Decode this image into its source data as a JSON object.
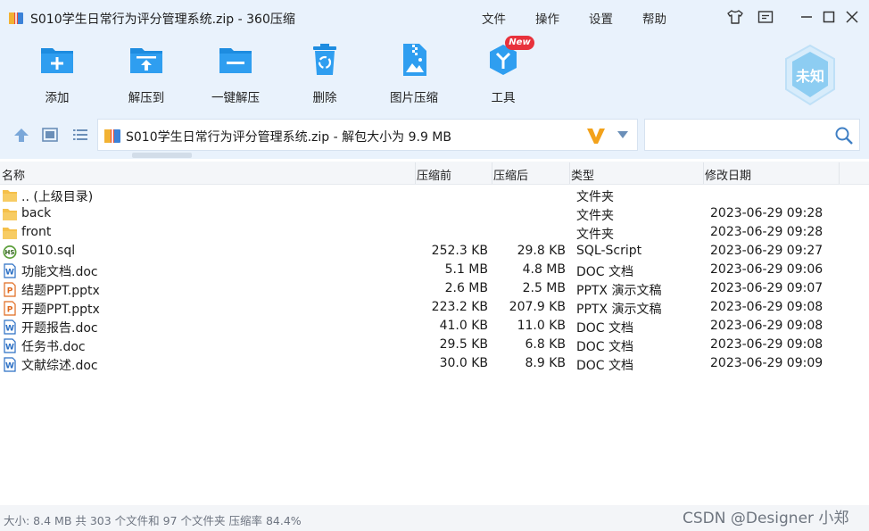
{
  "window": {
    "title": "S010学生日常行为评分管理系统.zip - 360压缩",
    "menu": [
      "文件",
      "操作",
      "设置",
      "帮助"
    ]
  },
  "toolbar": {
    "buttons": [
      {
        "label": "添加",
        "icon": "add-icon"
      },
      {
        "label": "解压到",
        "icon": "extract-to-icon"
      },
      {
        "label": "一键解压",
        "icon": "one-click-extract-icon"
      },
      {
        "label": "删除",
        "icon": "delete-icon"
      },
      {
        "label": "图片压缩",
        "icon": "image-compress-icon"
      },
      {
        "label": "工具",
        "icon": "tools-icon"
      }
    ],
    "new_badge": "New",
    "status_badge": "未知"
  },
  "address": {
    "path": "S010学生日常行为评分管理系统.zip - 解包大小为 9.9 MB",
    "search_value": ""
  },
  "columns": [
    "名称",
    "压缩前",
    "压缩后",
    "类型",
    "修改日期"
  ],
  "files": [
    {
      "name": ".. (上级目录)",
      "compressed": "",
      "original": "",
      "type": "文件夹",
      "date": "",
      "icon": "folder-up-icon"
    },
    {
      "name": "back",
      "compressed": "",
      "original": "",
      "type": "文件夹",
      "date": "2023-06-29 09:28",
      "icon": "folder-icon"
    },
    {
      "name": "front",
      "compressed": "",
      "original": "",
      "type": "文件夹",
      "date": "2023-06-29 09:28",
      "icon": "folder-icon"
    },
    {
      "name": "S010.sql",
      "compressed": "252.3 KB",
      "original": "29.8 KB",
      "type": "SQL-Script",
      "date": "2023-06-29 09:27",
      "icon": "sql-file-icon"
    },
    {
      "name": "功能文档.doc",
      "compressed": "5.1 MB",
      "original": "4.8 MB",
      "type": "DOC 文档",
      "date": "2023-06-29 09:06",
      "icon": "doc-file-icon"
    },
    {
      "name": "结题PPT.pptx",
      "compressed": "2.6 MB",
      "original": "2.5 MB",
      "type": "PPTX 演示文稿",
      "date": "2023-06-29 09:07",
      "icon": "ppt-file-icon"
    },
    {
      "name": "开题PPT.pptx",
      "compressed": "223.2 KB",
      "original": "207.9 KB",
      "type": "PPTX 演示文稿",
      "date": "2023-06-29 09:08",
      "icon": "ppt-file-icon"
    },
    {
      "name": "开题报告.doc",
      "compressed": "41.0 KB",
      "original": "11.0 KB",
      "type": "DOC 文档",
      "date": "2023-06-29 09:08",
      "icon": "doc-file-icon"
    },
    {
      "name": "任务书.doc",
      "compressed": "29.5 KB",
      "original": "6.8 KB",
      "type": "DOC 文档",
      "date": "2023-06-29 09:08",
      "icon": "doc-file-icon"
    },
    {
      "name": "文献综述.doc",
      "compressed": "30.0 KB",
      "original": "8.9 KB",
      "type": "DOC 文档",
      "date": "2023-06-29 09:09",
      "icon": "doc-file-icon"
    }
  ],
  "status": {
    "summary": "大小: 8.4 MB 共 303 个文件和 97 个文件夹 压缩率 84.4%",
    "watermark": "CSDN @Designer 小郑"
  },
  "colors": {
    "top_bg": "#e9f2fc",
    "accent_blue": "#1d8ce0",
    "folder": "#f5c04a",
    "new_badge": "#e8323c"
  }
}
